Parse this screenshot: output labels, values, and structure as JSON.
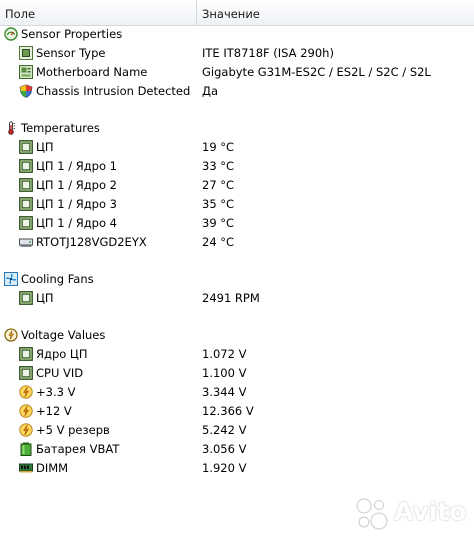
{
  "header": {
    "col_name": "Поле",
    "col_value": "Значение"
  },
  "groups": [
    {
      "title": "Sensor Properties",
      "icon": "sensor-gauge-icon",
      "items": [
        {
          "label": "Sensor Type",
          "value": "ITE IT8718F  (ISA 290h)",
          "icon": "chip-board-icon"
        },
        {
          "label": "Motherboard Name",
          "value": "Gigabyte G31M-ES2C / ES2L / S2C / S2L",
          "icon": "motherboard-icon"
        },
        {
          "label": "Chassis Intrusion Detected",
          "value": "Да",
          "icon": "shield-icon"
        }
      ]
    },
    {
      "title": "Temperatures",
      "icon": "thermometer-icon",
      "items": [
        {
          "label": "ЦП",
          "value": "19 °C",
          "icon": "cpu-chip-icon"
        },
        {
          "label": "ЦП 1 / Ядро 1",
          "value": "33 °C",
          "icon": "cpu-chip-icon"
        },
        {
          "label": "ЦП 1 / Ядро 2",
          "value": "27 °C",
          "icon": "cpu-chip-icon"
        },
        {
          "label": "ЦП 1 / Ядро 3",
          "value": "35 °C",
          "icon": "cpu-chip-icon"
        },
        {
          "label": "ЦП 1 / Ядро 4",
          "value": "39 °C",
          "icon": "cpu-chip-icon"
        },
        {
          "label": "RTOTJ128VGD2EYX",
          "value": "24 °C",
          "icon": "drive-icon"
        }
      ]
    },
    {
      "title": "Cooling Fans",
      "icon": "fan-icon",
      "items": [
        {
          "label": "ЦП",
          "value": "2491 RPM",
          "icon": "cpu-chip-icon"
        }
      ]
    },
    {
      "title": "Voltage Values",
      "icon": "voltage-gauge-icon",
      "items": [
        {
          "label": "Ядро ЦП",
          "value": "1.072 V",
          "icon": "cpu-chip-icon"
        },
        {
          "label": "CPU VID",
          "value": "1.100 V",
          "icon": "cpu-chip-icon"
        },
        {
          "label": "+3.3 V",
          "value": "3.344 V",
          "icon": "lightning-icon"
        },
        {
          "label": "+12 V",
          "value": "12.366 V",
          "icon": "lightning-icon"
        },
        {
          "label": "+5 V резерв",
          "value": "5.242 V",
          "icon": "lightning-icon"
        },
        {
          "label": "Батарея VBAT",
          "value": "3.056 V",
          "icon": "battery-icon"
        },
        {
          "label": "DIMM",
          "value": "1.920 V",
          "icon": "memory-module-icon"
        }
      ]
    }
  ],
  "watermark": {
    "text": "Avito"
  }
}
